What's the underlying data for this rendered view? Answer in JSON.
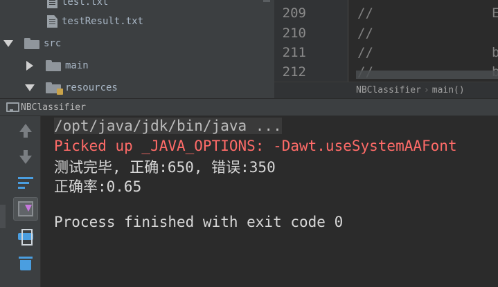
{
  "project_tree": {
    "items": [
      {
        "name": "test.txt",
        "kind": "file"
      },
      {
        "name": "testResult.txt",
        "kind": "file"
      },
      {
        "name": "src",
        "kind": "folder",
        "expanded": true
      },
      {
        "name": "main",
        "kind": "folder",
        "expanded": false
      },
      {
        "name": "resources",
        "kind": "resources-folder",
        "expanded": true
      }
    ]
  },
  "editor": {
    "lines": [
      {
        "number": "209",
        "code": "//",
        "tail": "E"
      },
      {
        "number": "210",
        "code": "//",
        "tail": ""
      },
      {
        "number": "211",
        "code": "//",
        "tail": "b"
      },
      {
        "number": "212",
        "code": "//",
        "tail": "b"
      }
    ],
    "breadcrumb": {
      "class_name": "NBClassifier",
      "method": "main()"
    }
  },
  "run_window": {
    "tab_label": "NBClassifier",
    "toolbar_icons": [
      "up-arrow-icon",
      "down-arrow-icon",
      "soft-wrap-icon",
      "scroll-to-end-icon",
      "print-icon",
      "trash-icon"
    ],
    "console": {
      "command": "/opt/java/jdk/bin/java ...",
      "warning": "Picked up _JAVA_OPTIONS: -Dawt.useSystemAAFont",
      "result": "测试完毕, 正确:650, 错误:350",
      "accuracy": "正确率:0.65",
      "exit_message": "Process finished with exit code 0"
    }
  },
  "colors": {
    "panel_bg": "#3c3f41",
    "editor_bg": "#2b2b2b",
    "error_text": "#ff6b68",
    "accent_blue": "#4a9ee0"
  }
}
